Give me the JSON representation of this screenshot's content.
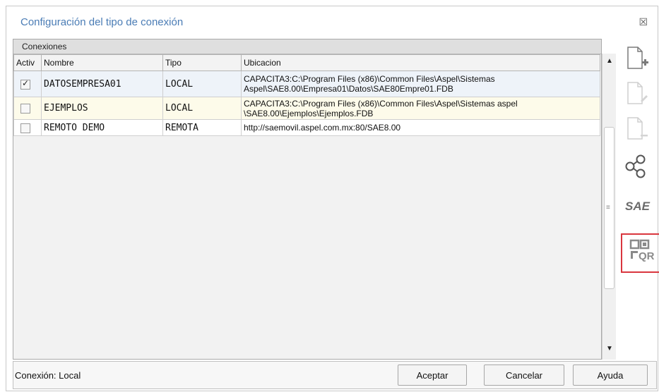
{
  "window": {
    "title": "Configuración del tipo de conexión",
    "close_glyph": "☒"
  },
  "grid": {
    "group_label": "Conexiones",
    "columns": [
      "Activ",
      "Nombre",
      "Tipo",
      "Ubicacion"
    ],
    "rows": [
      {
        "active": true,
        "nombre": "DATOSEMPRESA01",
        "tipo": "LOCAL",
        "ubicacion": "CAPACITA3:C:\\Program Files (x86)\\Common Files\\Aspel\\Sistemas Aspel\\SAE8.00\\Empresa01\\Datos\\SAE80Empre01.FDB"
      },
      {
        "active": false,
        "nombre": "EJEMPLOS",
        "tipo": "LOCAL",
        "ubicacion": "CAPACITA3:C:\\Program Files (x86)\\Common Files\\Aspel\\Sistemas aspel \\SAE8.00\\Ejemplos\\Ejemplos.FDB"
      },
      {
        "active": false,
        "nombre": "REMOTO DEMO",
        "tipo": "REMOTA",
        "ubicacion": "http://saemovil.aspel.com.mx:80/SAE8.00"
      }
    ]
  },
  "toolbar": {
    "sae_label": "SAE",
    "qr_label": "QR",
    "icons": [
      "new-document-icon",
      "edit-document-icon",
      "remove-document-icon",
      "share-icon",
      "sae-icon",
      "qr-code-icon"
    ]
  },
  "status": {
    "text": "Conexión: Local"
  },
  "buttons": {
    "accept_label": "Aceptar",
    "cancel_label": "Cancelar",
    "help_label": "Ayuda"
  },
  "colors": {
    "title": "#4a7cb5",
    "highlight_border": "#d9363e",
    "row_selected": "#eef3f9",
    "row_alt": "#fdfbea"
  }
}
